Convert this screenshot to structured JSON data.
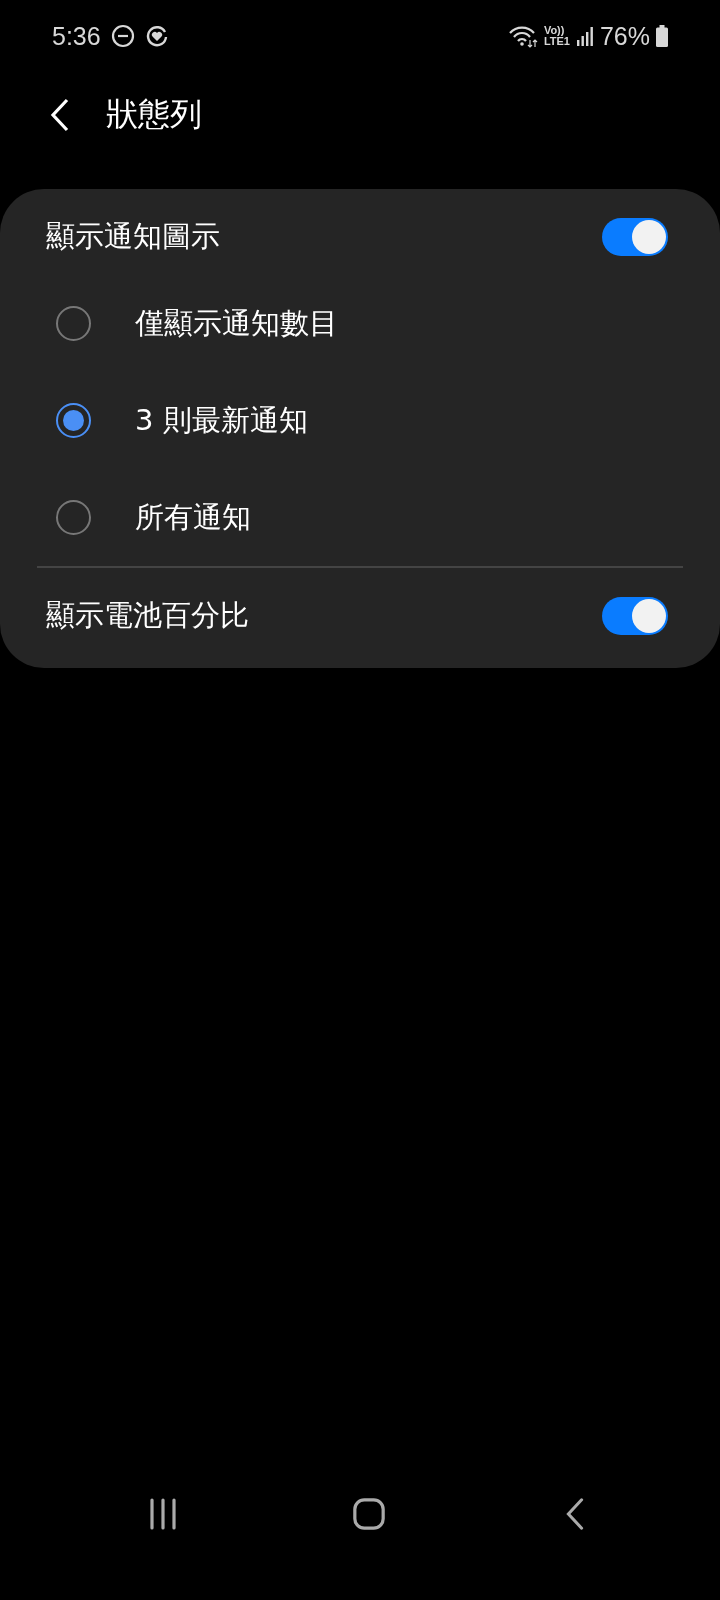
{
  "status_bar": {
    "time": "5:36",
    "volte_top": "Vo))",
    "volte_bottom": "LTE1",
    "battery": "76%"
  },
  "header": {
    "title": "狀態列"
  },
  "sections": [
    {
      "toggle": {
        "label": "顯示通知圖示",
        "on": true
      },
      "options": [
        {
          "label": "僅顯示通知數目",
          "selected": false
        },
        {
          "label": "3 則最新通知",
          "selected": true
        },
        {
          "label": "所有通知",
          "selected": false
        }
      ]
    },
    {
      "toggle": {
        "label": "顯示電池百分比",
        "on": true
      }
    }
  ]
}
